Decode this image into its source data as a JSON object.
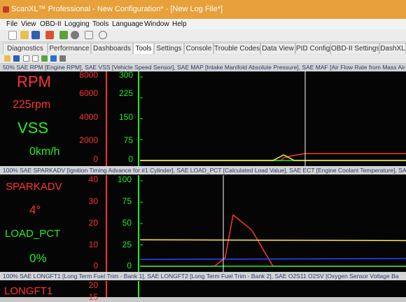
{
  "window": {
    "title": "ScanXL™ Professional - New Configuration* - [New Log File*]"
  },
  "menu": [
    "File",
    "View",
    "OBD-II",
    "Logging",
    "Tools",
    "Language",
    "Window",
    "Help"
  ],
  "tabs": [
    "Diagnostics",
    "Performance",
    "Dashboards",
    "Tools",
    "Settings",
    "Console",
    "Trouble Codes",
    "Data View",
    "PID Config",
    "OBD-II Settings",
    "DashXL"
  ],
  "active_tab": "Tools",
  "colors": {
    "rpm": "#ff3333",
    "vss": "#22ee22",
    "sparkadv": "#ff3333",
    "load_pct": "#22ee22",
    "ect": "#ffee33",
    "map": "#ffee33",
    "maf": "#3344ff",
    "cursor": "#ffffff",
    "titlebar": "#e7a03a"
  },
  "chart1": {
    "header": "50% SAE RPM [Engine RPM], SAE VSS [Vehicle Speed Sensor], SAE MAP [Intake Manifold Absolute Pressure], SAE MAF [Air Flow Rate from Mass Air",
    "label1": "RPM",
    "value1": "225rpm",
    "label2": "VSS",
    "value2": "0km/h",
    "rpm_ticks": [
      "8000",
      "6000",
      "4000",
      "2000",
      "0"
    ],
    "vss_ticks": [
      "300",
      "225",
      "150",
      "75",
      "0"
    ]
  },
  "chart2": {
    "header": "100% SAE SPARKADV [Ignition Timing Advance for #1 Cylinder], SAE LOAD_PCT [Calculated Load Value], SAE ECT [Engine Coolant Temperature], SAE",
    "label1": "SPARKADV",
    "value1": "4°",
    "label2": "LOAD_PCT",
    "value2": "0%",
    "spark_ticks": [
      "40",
      "30",
      "20",
      "10",
      "0"
    ],
    "load_ticks": [
      "100",
      "75",
      "50",
      "25",
      "0"
    ]
  },
  "chart3": {
    "header": "100% SAE LONGFT1 [Long Term Fuel Trim - Bank 1], SAE LONGFT2 [Long Term Fuel Trim - Bank 2], SAE O2S11 O2SV [Oxygen Sensor Voltage Ba",
    "label1": "LONGFT1",
    "ticks": [
      "20",
      "15"
    ]
  },
  "chart_data": [
    {
      "type": "line",
      "series": [
        {
          "name": "RPM",
          "x": [
            0,
            53,
            54,
            58,
            62,
            100
          ],
          "values": [
            0,
            0,
            250,
            500,
            650,
            650
          ]
        },
        {
          "name": "VSS",
          "x": [
            0,
            100
          ],
          "values": [
            0,
            0
          ]
        },
        {
          "name": "MAP",
          "x": [
            0,
            50,
            54,
            58,
            100
          ],
          "values": [
            0,
            0,
            20,
            0,
            0
          ]
        }
      ],
      "ylim_left": [
        0,
        8000
      ],
      "ylim_right": [
        0,
        300
      ]
    },
    {
      "type": "line",
      "series": [
        {
          "name": "SPARKADV",
          "x": [
            0,
            28,
            32,
            35,
            42,
            50,
            100
          ],
          "values": [
            0,
            0,
            4,
            24,
            17,
            0,
            0
          ]
        },
        {
          "name": "LOAD_PCT",
          "x": [
            0,
            100
          ],
          "values": [
            0,
            0
          ]
        },
        {
          "name": "ECT",
          "x": [
            0,
            100
          ],
          "values": [
            31,
            30
          ]
        },
        {
          "name": "MAF",
          "x": [
            0,
            100
          ],
          "values": [
            8,
            9
          ]
        }
      ],
      "ylim_left": [
        0,
        40
      ],
      "ylim_right": [
        0,
        100
      ]
    }
  ]
}
